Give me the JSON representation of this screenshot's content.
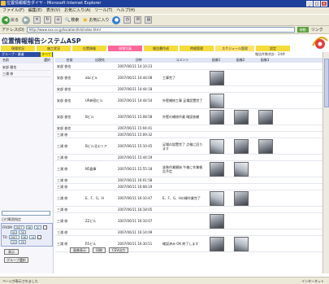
{
  "window": {
    "title": "位置情報報告ダイヤ - Microsoft Internet Explorer"
  },
  "menu": [
    "ファイル(F)",
    "編集(E)",
    "表示(V)",
    "お気に入り(A)",
    "ツール(T)",
    "ヘルプ(H)"
  ],
  "toolbar": {
    "back": "戻る",
    "search": "検索",
    "favorites": "お気に入り"
  },
  "address": {
    "label": "アドレス(D)",
    "url": "http://www.xxx.co.jp/location/list/index.html",
    "go": "移動",
    "links": "リンク"
  },
  "app": {
    "title": "位置情報報告システムASP"
  },
  "nav": [
    "現場状況",
    "施工状況",
    "位置情報",
    "現場写真",
    "報告書作成",
    "時間管理",
    "スケジュール管理",
    "設定"
  ],
  "status_strip": "報告件数合計：24件",
  "sidebar": {
    "head": "グループ・業者",
    "select": "すべて",
    "col_name": "名前",
    "col_check": "選択",
    "items": [
      "安部 健也",
      "三浦 修"
    ]
  },
  "search": {
    "date_label": "日付範囲指定",
    "from_label": "FROM",
    "to_label": "TO",
    "from": {
      "year": "2007",
      "month": "06",
      "day": "10"
    },
    "to": {
      "year": "2007",
      "month": "06",
      "day": "14"
    },
    "from_time": {
      "hour": "00",
      "min": "00"
    },
    "to_time": {
      "hour": "23",
      "min": "59"
    },
    "show_btn": "表示",
    "group_btn": "グループ選択"
  },
  "table": {
    "headers": [
      "名前",
      "出現先",
      "日時",
      "コメント",
      "画像1",
      "画像2",
      "画像3"
    ],
    "rows": [
      {
        "name": "安部 俊也",
        "place": "",
        "date": "2007/06/11 14:10:23",
        "report": "",
        "photos": []
      },
      {
        "name": "安部 俊也",
        "place": "abcビル",
        "date": "2007/06/11 14:44:08",
        "report": "工事完了",
        "photos": [
          "dark"
        ]
      },
      {
        "name": "安部 俊也",
        "place": "",
        "date": "2007/06/11 14:44:18",
        "report": "",
        "photos": []
      },
      {
        "name": "安部 俊也",
        "place": "UR新宿ビル",
        "date": "2007/06/11 14:44:54",
        "report": "外壁補修工事 足場設置完了",
        "photos": [
          "light"
        ]
      },
      {
        "name": "安部 俊也",
        "place": "Bビル",
        "date": "2007/06/11 15:08:58",
        "report": "外壁の補修作業 確認依頼",
        "photos": [
          "dark",
          "dark",
          "dark"
        ]
      },
      {
        "name": "安部 俊也",
        "place": "",
        "date": "2007/06/11 15:04:41",
        "report": "",
        "photos": []
      },
      {
        "name": "三浦 修",
        "place": "",
        "date": "2007/06/11 15:09:32",
        "report": "",
        "photos": []
      },
      {
        "name": "三浦 修",
        "place": "Bビル北エリア",
        "date": "2007/06/11 15:10:45",
        "report": "足場の設置完了 点検に回ります",
        "photos": [
          "light",
          "dark",
          "dark"
        ]
      },
      {
        "name": "三浦 修",
        "place": "",
        "date": "2007/06/11 15:44:19",
        "report": "",
        "photos": []
      },
      {
        "name": "三浦 修",
        "place": "N5倉庫",
        "date": "2007/06/11 15:55:18",
        "report": "塗装作業開始 午後に作業報告予定",
        "photos": [
          "dark",
          "light"
        ]
      },
      {
        "name": "三浦 修",
        "place": "",
        "date": "2007/06/11 16:01:58",
        "report": "",
        "photos": []
      },
      {
        "name": "三浦 修",
        "place": "",
        "date": "2007/06/11 16:08:19",
        "report": "",
        "photos": []
      },
      {
        "name": "三浦 修",
        "place": "E、F、G、H",
        "date": "2007/06/11 16:10:47",
        "report": "E、F、G、Hの棟作業完了",
        "photos": [
          "light",
          "dark"
        ]
      },
      {
        "name": "三浦 修",
        "place": "",
        "date": "2007/06/11 16:18:05",
        "report": "",
        "photos": []
      },
      {
        "name": "三浦 修",
        "place": "ZZビル",
        "date": "2007/06/11 16:10:07",
        "report": "",
        "photos": [
          "dark"
        ]
      },
      {
        "name": "三浦 修",
        "place": "",
        "date": "2007/06/11 16:14:09",
        "report": "",
        "photos": []
      },
      {
        "name": "三浦 修",
        "place": "R5ビル",
        "date": "2007/06/11 16:30:51",
        "report": "確認済み OK 終了します",
        "photos": [
          "dark",
          "light"
        ]
      }
    ]
  },
  "bottom_buttons": [
    "画像表示",
    "印刷",
    "CSV出力"
  ],
  "statusbar": {
    "left": "ページが表示されました",
    "right": "インターネット"
  }
}
